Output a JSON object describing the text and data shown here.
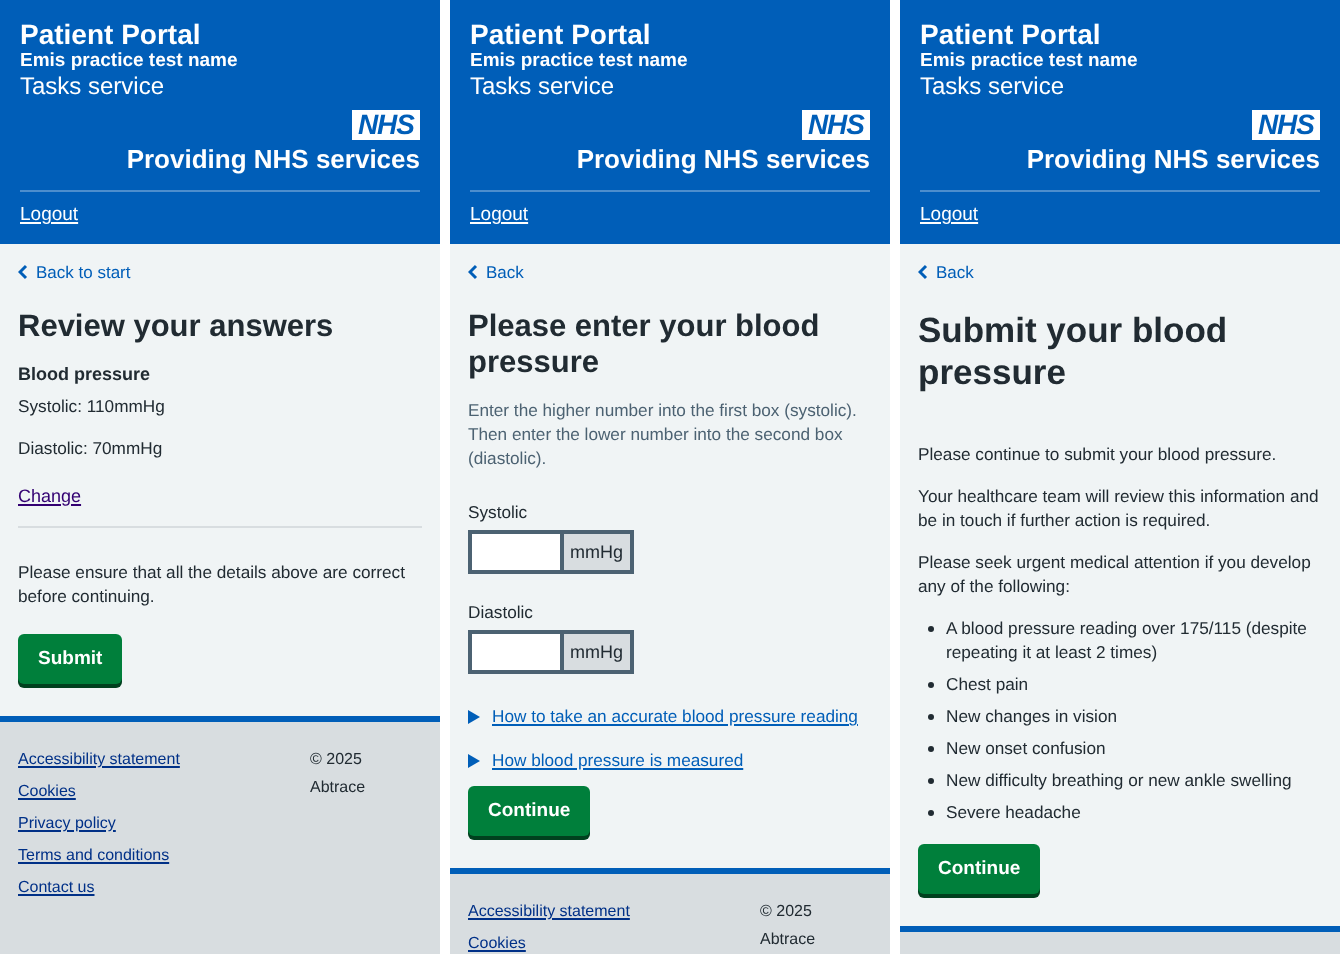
{
  "screens": [
    {
      "header": {
        "title": "Patient Portal",
        "practice": "Emis practice test name",
        "service": "Tasks service",
        "logo": "NHS",
        "tagline": "Providing NHS services",
        "logout": "Logout"
      },
      "blocks": [
        {
          "kind": "back",
          "text": "Back to start"
        },
        {
          "kind": "heading",
          "text": "Review your answers",
          "large": false
        },
        {
          "kind": "label",
          "text": "Blood pressure"
        },
        {
          "kind": "text",
          "text": "Systolic: 110mmHg"
        },
        {
          "kind": "text",
          "text": "Diastolic: 70mmHg"
        },
        {
          "kind": "link",
          "text": "Change",
          "visited": true
        },
        {
          "kind": "divider"
        },
        {
          "kind": "text",
          "text": "Please ensure that all the details above are correct before continuing."
        },
        {
          "kind": "button",
          "text": "Submit"
        }
      ],
      "footer": {
        "links": [
          "Accessibility statement",
          "Cookies",
          "Privacy policy",
          "Terms and conditions",
          "Contact us"
        ],
        "copyright": [
          "© 2025",
          "Abtrace"
        ]
      }
    },
    {
      "header": {
        "title": "Patient Portal",
        "practice": "Emis practice test name",
        "service": "Tasks service",
        "logo": "NHS",
        "tagline": "Providing NHS services",
        "logout": "Logout"
      },
      "blocks": [
        {
          "kind": "back",
          "text": "Back"
        },
        {
          "kind": "heading",
          "text": "Please enter your blood pressure",
          "large": false
        },
        {
          "kind": "hint",
          "text": "Enter the higher number into the first box (systolic). Then enter the lower number into the second box (diastolic)."
        },
        {
          "kind": "input",
          "label": "Systolic",
          "suffix": "mmHg"
        },
        {
          "kind": "input",
          "label": "Diastolic",
          "suffix": "mmHg"
        },
        {
          "kind": "details",
          "text": "How to take an accurate blood pressure reading"
        },
        {
          "kind": "details",
          "text": "How blood pressure is measured"
        },
        {
          "kind": "button",
          "text": "Continue"
        }
      ],
      "footer": {
        "links": [
          "Accessibility statement",
          "Cookies"
        ],
        "copyright": [
          "© 2025",
          "Abtrace"
        ]
      }
    },
    {
      "header": {
        "title": "Patient Portal",
        "practice": "Emis practice test name",
        "service": "Tasks service",
        "logo": "NHS",
        "tagline": "Providing NHS services",
        "logout": "Logout"
      },
      "blocks": [
        {
          "kind": "back",
          "text": "Back"
        },
        {
          "kind": "heading",
          "text": "Submit your blood pressure",
          "large": true
        },
        {
          "kind": "text",
          "text": "Please continue to submit your blood pressure."
        },
        {
          "kind": "text",
          "text": "Your healthcare team will review this information and be in touch if further action is required."
        },
        {
          "kind": "text",
          "text": "Please seek urgent medical attention if you develop any of the following:"
        },
        {
          "kind": "bullets",
          "items": [
            "A blood pressure reading over 175/115 (despite repeating it at least 2 times)",
            "Chest pain",
            "New changes in vision",
            "New onset confusion",
            "New difficulty breathing or new ankle swelling",
            "Severe headache"
          ]
        },
        {
          "kind": "button",
          "text": "Continue"
        }
      ]
    }
  ]
}
